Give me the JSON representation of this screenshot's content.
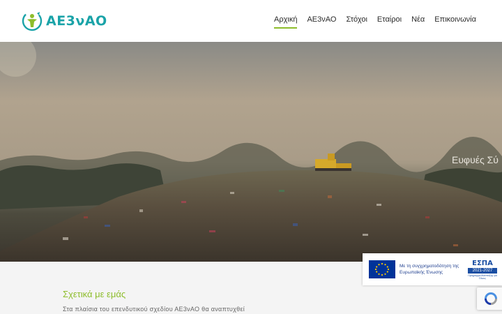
{
  "brand": {
    "name": "ΑΕ3νΑΟ",
    "primary_color": "#1aa3a8",
    "accent_color": "#8dbd2b"
  },
  "nav": {
    "items": [
      {
        "label": "Αρχική",
        "active": true
      },
      {
        "label": "ΑΕ3νΑΟ",
        "active": false
      },
      {
        "label": "Στόχοι",
        "active": false
      },
      {
        "label": "Εταίροι",
        "active": false
      },
      {
        "label": "Νέα",
        "active": false
      },
      {
        "label": "Επικοινωνία",
        "active": false
      }
    ]
  },
  "hero": {
    "caption": "Ευφυές Σύ",
    "image_icon": "landfill-photo"
  },
  "about": {
    "title": "Σχετικά με εμάς",
    "text": "Στα πλαίσια του επενδυτικού σχεδίου ΑΕ3νΑΟ θα αναπτυχθεί"
  },
  "espa_banner": {
    "text": "Με τη συγχρηματοδότηση της Ευρωπαϊκής Ένωσης",
    "logo_word": "ΕΣΠΑ",
    "logo_years": "2021-2027",
    "logo_subtitle": "Πρόγραμμα Ανάπτυξης για Όλους",
    "flag_icon": "eu-flag-icon"
  },
  "recaptcha": {
    "icon": "recaptcha-icon"
  }
}
